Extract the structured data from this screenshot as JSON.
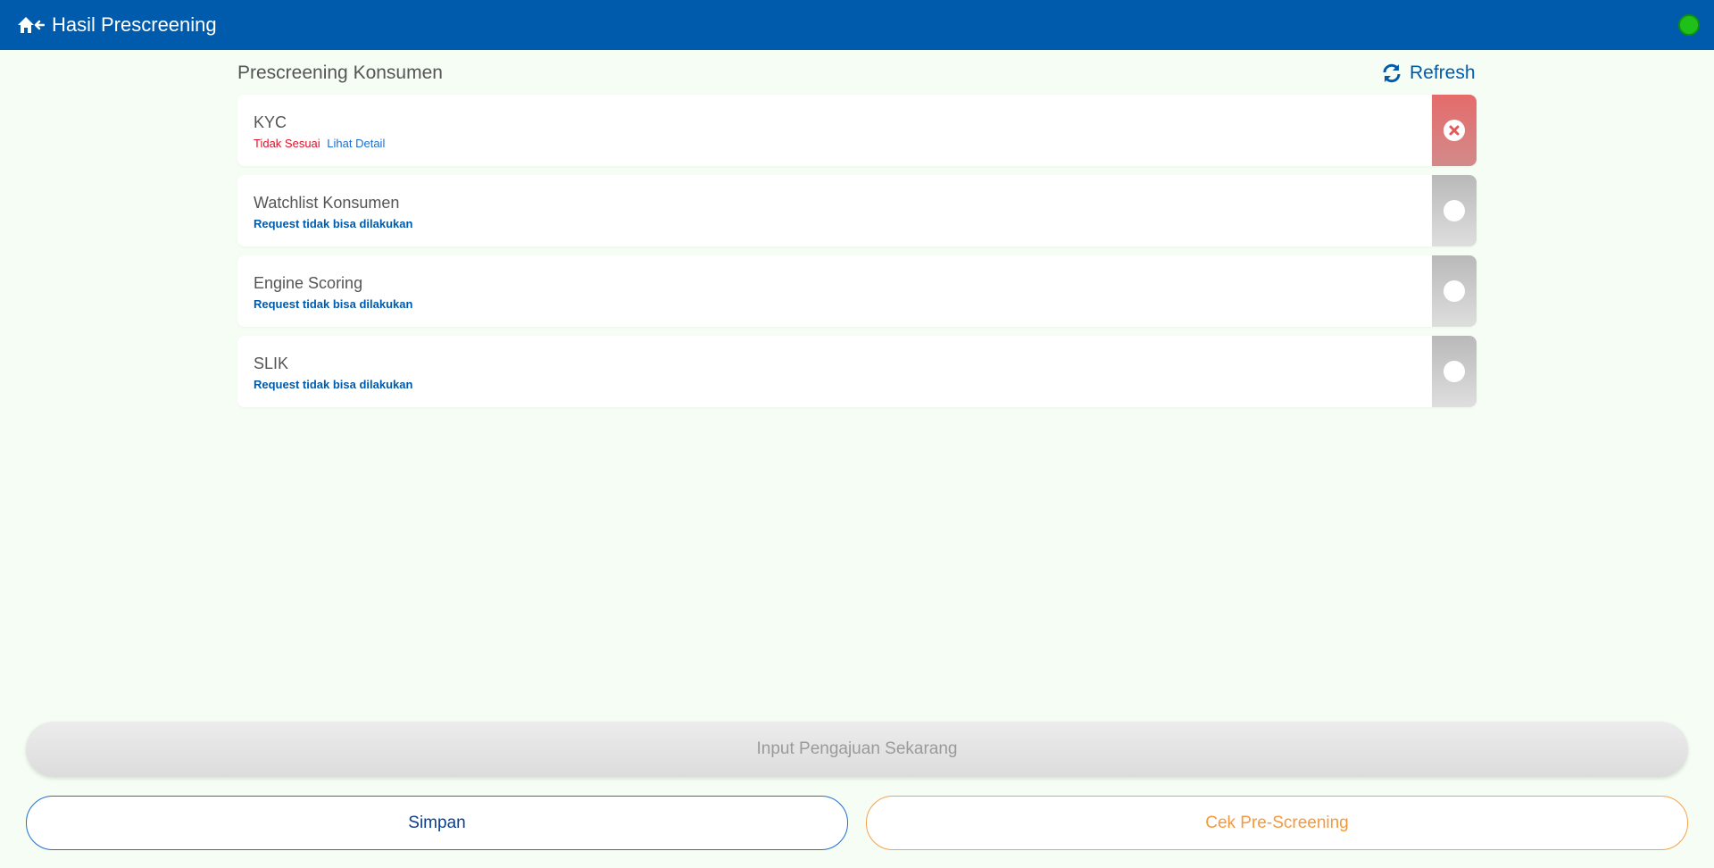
{
  "header": {
    "title": "Hasil Prescreening",
    "status_color": "#1fc01a"
  },
  "section": {
    "title": "Prescreening Konsumen",
    "refresh_label": "Refresh"
  },
  "items": [
    {
      "name": "KYC",
      "status": "Tidak Sesuai",
      "link": "Lihat Detail",
      "state": "failed",
      "icon": "close-icon"
    },
    {
      "name": "Watchlist Konsumen",
      "status": "Request tidak bisa dilakukan",
      "state": "pending",
      "icon": "circle-icon"
    },
    {
      "name": "Engine Scoring",
      "status": "Request tidak bisa dilakukan",
      "state": "pending",
      "icon": "circle-icon"
    },
    {
      "name": "SLIK",
      "status": "Request tidak bisa dilakukan",
      "state": "pending",
      "icon": "circle-icon"
    }
  ],
  "actions": {
    "input_label": "Input Pengajuan Sekarang",
    "save_label": "Simpan",
    "check_label": "Cek Pre-Screening"
  },
  "colors": {
    "primary": "#005bac",
    "failed": "#e56b6b",
    "pending": "#c4c4c4",
    "accent_orange": "#f59a3c",
    "background": "#f5fdf5"
  }
}
